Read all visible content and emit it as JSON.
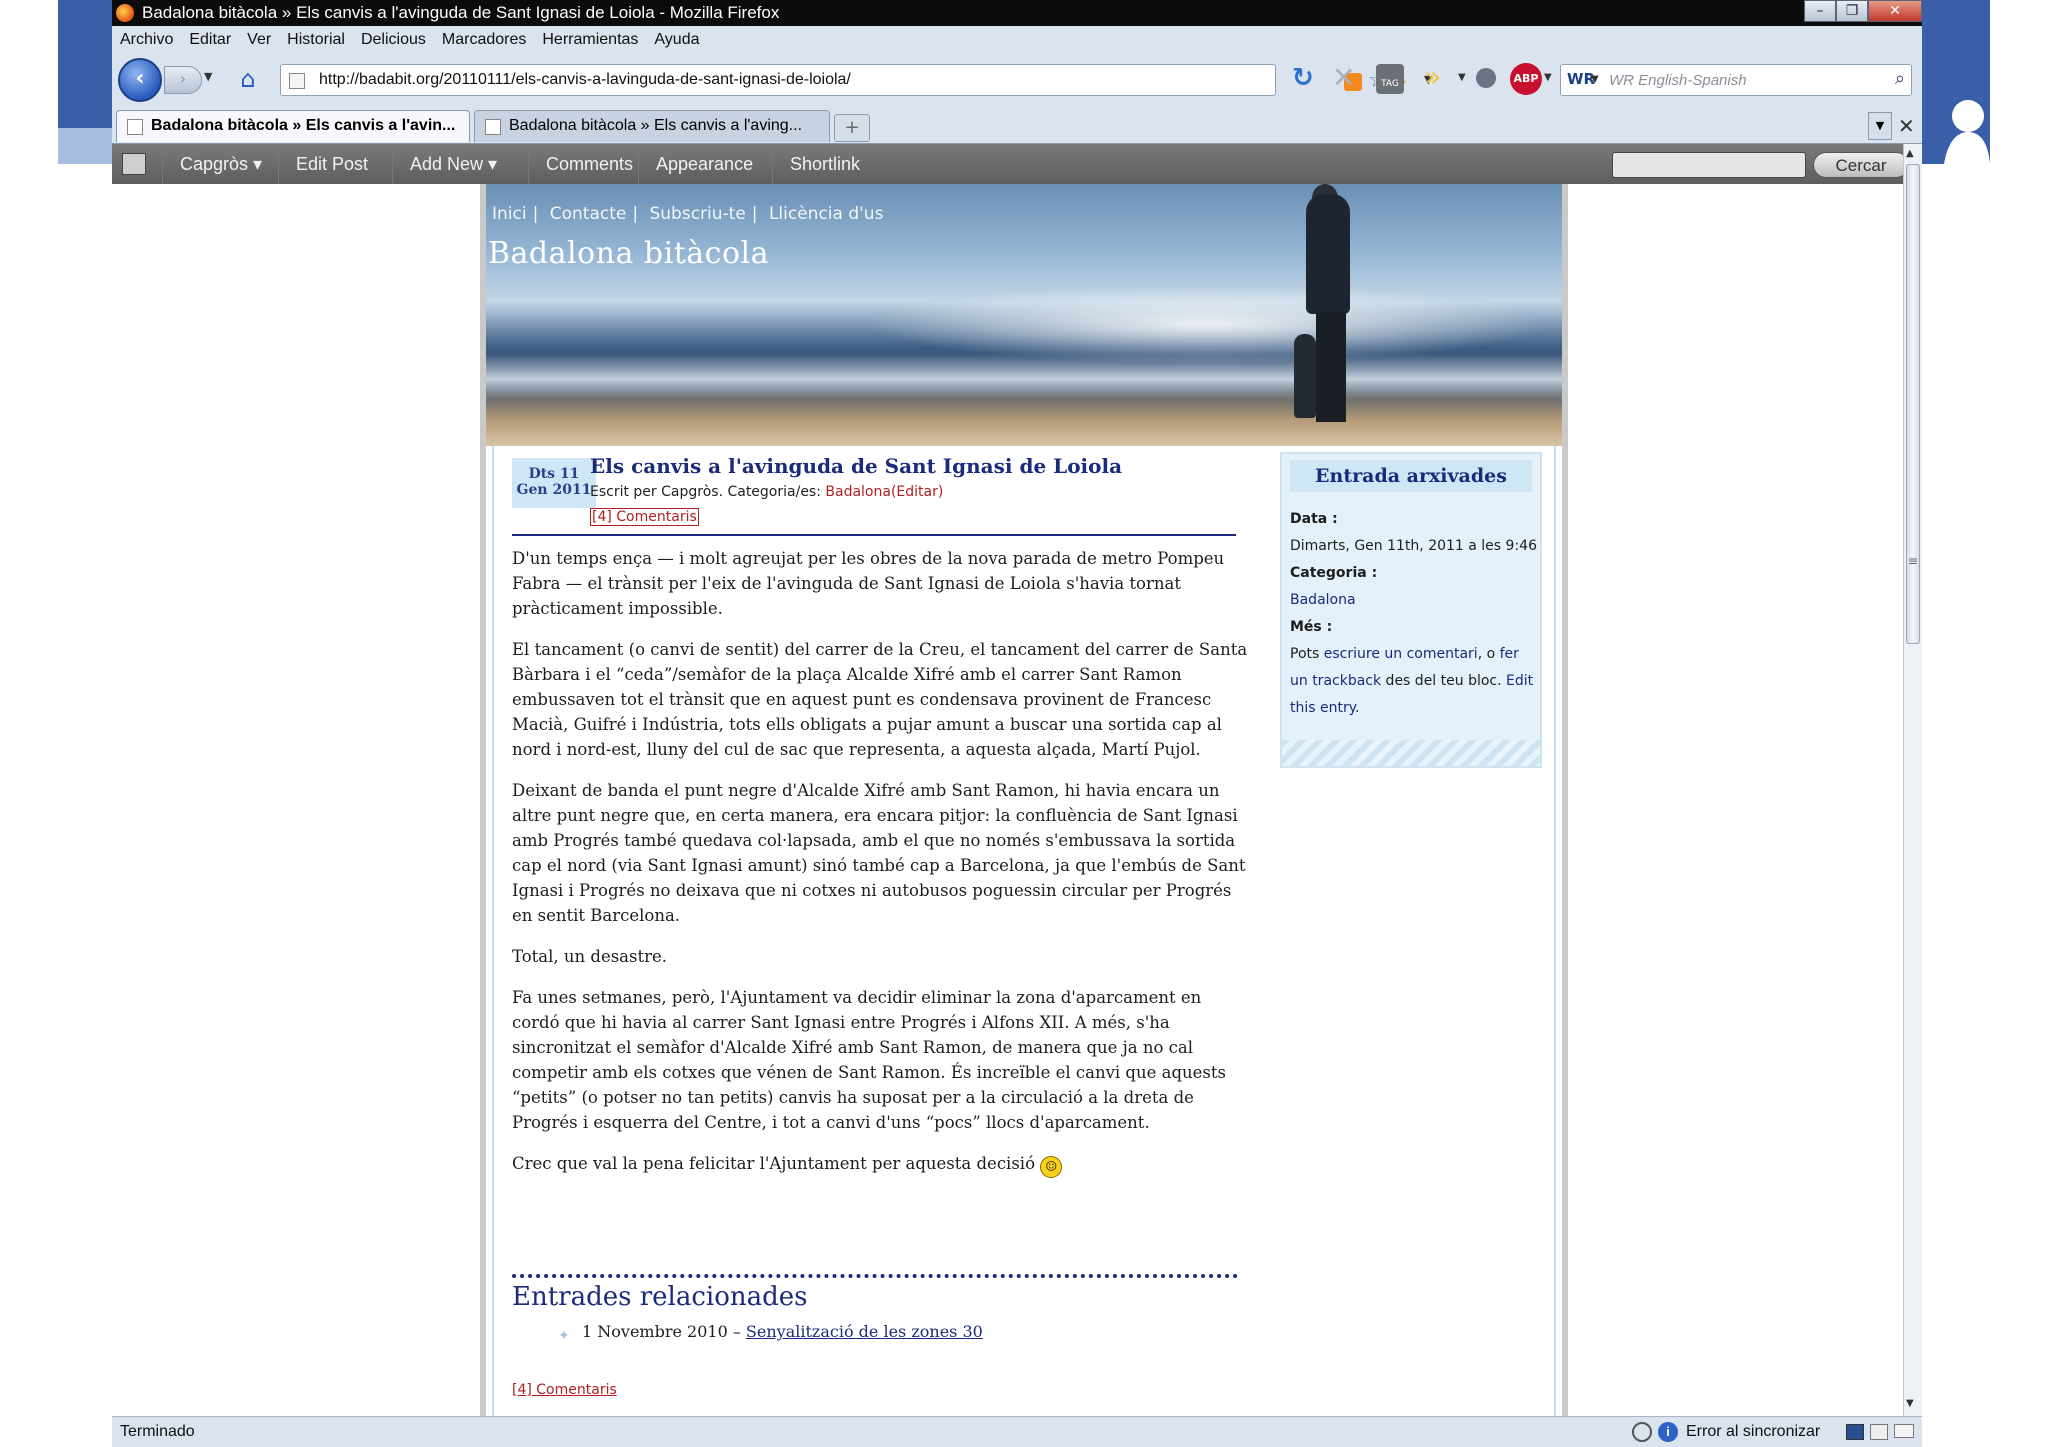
{
  "window": {
    "title": "Badalona bitàcola » Els canvis a l'avinguda de Sant Ignasi de Loiola - Mozilla Firefox",
    "minimize_glyph": "–",
    "maximize_glyph": "❐",
    "close_glyph": "✕"
  },
  "menubar": [
    "Archivo",
    "Editar",
    "Ver",
    "Historial",
    "Delicious",
    "Marcadores",
    "Herramientas",
    "Ayuda"
  ],
  "navbar": {
    "url": "http://badabit.org/20110111/els-canvis-a-lavinguda-de-sant-ignasi-de-loiola/",
    "search_placeholder": "WR English-Spanish",
    "search_engine": "WR",
    "abp_label": "ABP",
    "tag_label": "TAG"
  },
  "tabs": [
    {
      "label": "Badalona bitàcola » Els canvis a l'avin..."
    },
    {
      "label": "Badalona bitàcola » Els canvis a l'aving..."
    }
  ],
  "adminbar": {
    "items": [
      "Capgròs ▾",
      "Edit Post",
      "Add New ▾",
      "Comments",
      "Appearance",
      "Shortlink"
    ],
    "search_button": "Cercar"
  },
  "site": {
    "nav": [
      "Inici",
      "Contacte",
      "Subscriu-te",
      "Llicència d'us"
    ],
    "title": "Badalona bitàcola"
  },
  "post": {
    "date_day": "Dts 11",
    "date_month": "Gen 2011",
    "title": "Els canvis a l'avinguda de Sant Ignasi de Loiola",
    "meta_prefix": "Escrit per Capgròs. Categoria/es: ",
    "meta_category": "Badalona(Editar)",
    "comments": "[4] Comentaris",
    "paragraphs": [
      "D'un temps ença — i molt agreujat per les obres de la nova parada de metro Pompeu Fabra — el trànsit per l'eix de l'avinguda de Sant Ignasi de Loiola s'havia tornat pràcticament impossible.",
      "El tancament (o canvi de sentit) del carrer de la Creu, el tancament del carrer de Santa Bàrbara i el “ceda”/semàfor de la plaça Alcalde Xifré amb el carrer Sant Ramon embussaven tot el trànsit que en aquest punt es condensava provinent de Francesc Macià, Guifré i Indústria, tots ells obligats a pujar amunt a buscar una sortida cap al nord i nord-est, lluny del cul de sac que representa, a aquesta alçada, Martí Pujol.",
      "Deixant de banda el punt negre d'Alcalde Xifré amb Sant Ramon, hi havia encara un altre punt negre que, en certa manera, era encara pitjor: la confluència de Sant Ignasi amb Progrés també quedava col·lapsada, amb el que no només s'embussava la sortida cap el nord (via Sant Ignasi amunt) sinó també cap a Barcelona, ja que l'embús de Sant Ignasi i Progrés no deixava que ni cotxes ni autobusos poguessin circular per Progrés en sentit Barcelona.",
      "Total, un desastre.",
      "Fa unes setmanes, però, l'Ajuntament va decidir eliminar la zona d'aparcament en cordó que hi havia al carrer Sant Ignasi entre Progrés i Alfons XII. A més, s'ha sincronitzat el semàfor d'Alcalde Xifré amb Sant Ramon, de manera que ja no cal competir amb els cotxes que vénen de Sant Ramon. És increïble el canvi que aquests “petits” (o potser no tan petits) canvis ha suposat per a la circulació a la dreta de Progrés i esquerra del Centre, i tot a canvi d'uns “pocs” llocs d'aparcament."
    ],
    "closing": "Crec que val la pena felicitar l'Ajuntament per aquesta decisió",
    "related_heading": "Entrades relacionades",
    "related_date": "1 Novembre 2010 –",
    "related_link": "Senyalització de les zones 30",
    "comments_bottom": "[4] Comentaris"
  },
  "sidebar": {
    "heading": "Entrada arxivades",
    "data_label": "Data :",
    "data_value": "Dimarts, Gen 11th, 2011 a les 9:46",
    "cat_label": "Categoria :",
    "cat_value": "Badalona",
    "mes_label": "Més :",
    "mes_1": "Pots ",
    "mes_link1": "escriure un comentari",
    "mes_2": ", o ",
    "mes_link2": "fer un trackback",
    "mes_3": " des del teu bloc. ",
    "mes_link3": "Edit this entry",
    "mes_4": "."
  },
  "statusbar": {
    "left": "Terminado",
    "sync": "Error al sincronizar"
  }
}
